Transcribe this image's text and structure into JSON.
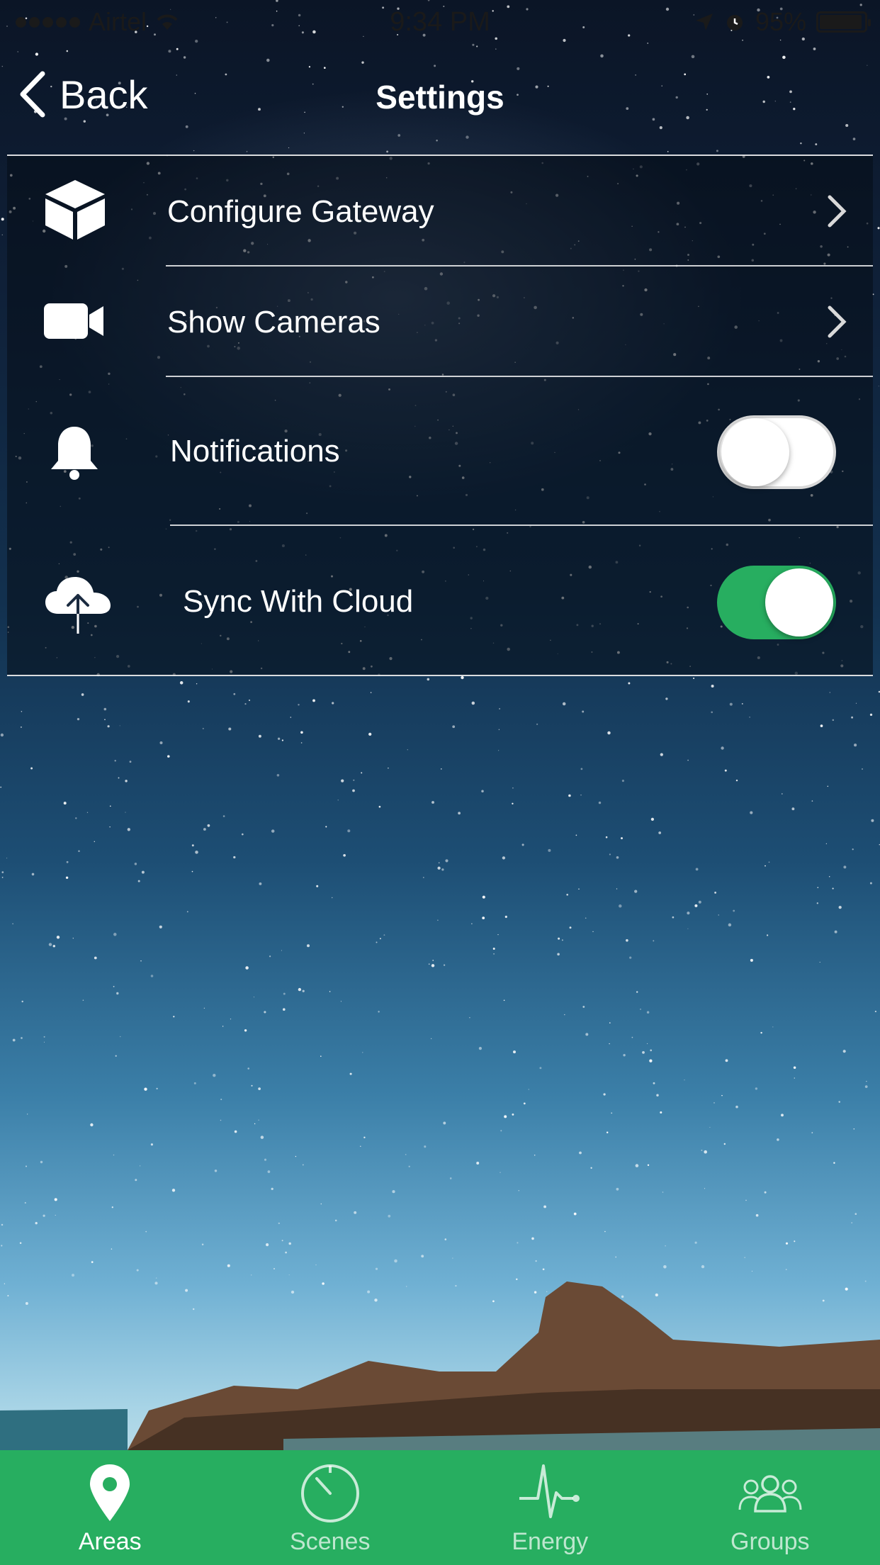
{
  "status_bar": {
    "carrier": "Airtel",
    "time": "9:34 PM",
    "battery": "95%",
    "signal_bars": 5
  },
  "nav": {
    "back_label": "Back",
    "title": "Settings"
  },
  "settings": {
    "items": [
      {
        "label": "Configure Gateway",
        "icon": "cube-icon",
        "control": "chevron"
      },
      {
        "label": "Show Cameras",
        "icon": "video-camera-icon",
        "control": "chevron"
      },
      {
        "label": "Notifications",
        "icon": "bell-icon",
        "control": "toggle",
        "on": false
      },
      {
        "label": "Sync With Cloud",
        "icon": "cloud-upload-icon",
        "control": "toggle",
        "on": true
      }
    ]
  },
  "tabbar": {
    "tabs": [
      {
        "label": "Areas",
        "icon": "map-pin-icon",
        "active": true
      },
      {
        "label": "Scenes",
        "icon": "dial-icon",
        "active": false
      },
      {
        "label": "Energy",
        "icon": "pulse-icon",
        "active": false
      },
      {
        "label": "Groups",
        "icon": "people-icon",
        "active": false
      }
    ]
  },
  "colors": {
    "accent_green": "#27ae60",
    "panel_overlay": "rgba(6,12,22,0.55)"
  }
}
